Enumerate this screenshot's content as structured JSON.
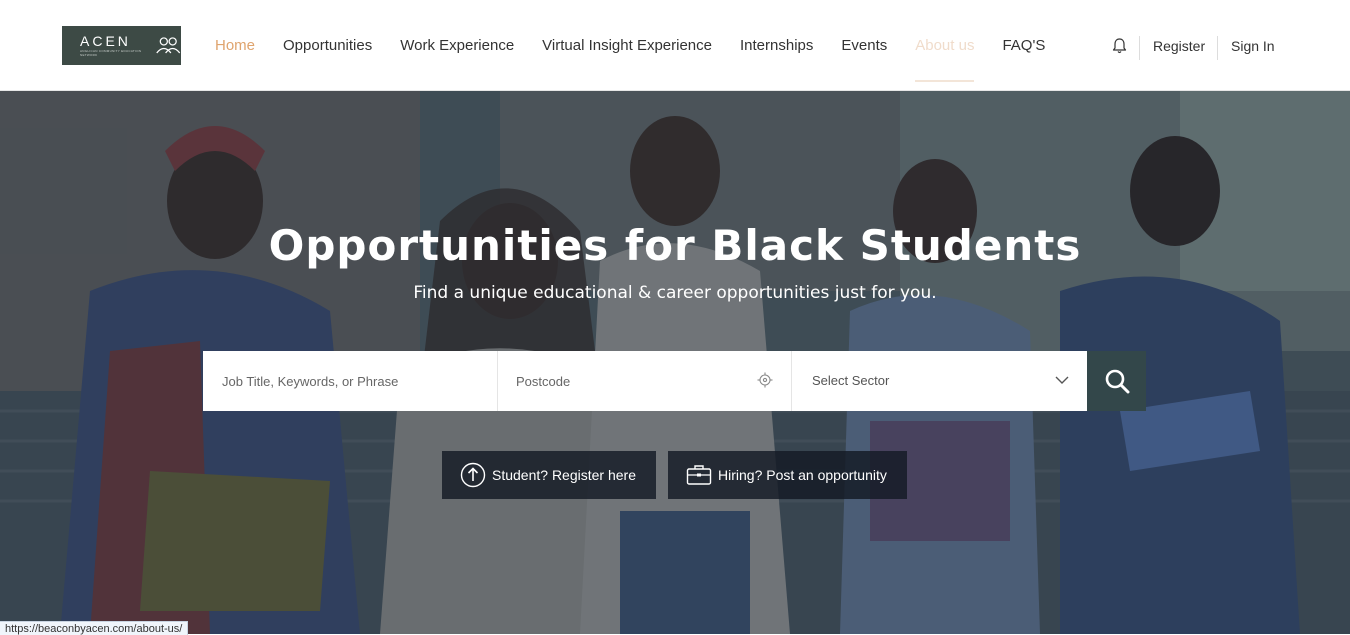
{
  "logo": {
    "word": "ACEN",
    "tagline": "ANGLICAN COMMUNITY EDUCATION NETWORK"
  },
  "nav": {
    "items": [
      {
        "label": "Home",
        "state": "active"
      },
      {
        "label": "Opportunities",
        "state": ""
      },
      {
        "label": "Work Experience",
        "state": ""
      },
      {
        "label": "Virtual Insight Experience",
        "state": ""
      },
      {
        "label": "Internships",
        "state": ""
      },
      {
        "label": "Events",
        "state": ""
      },
      {
        "label": "About us",
        "state": "hover"
      },
      {
        "label": "FAQ'S",
        "state": ""
      }
    ],
    "register": "Register",
    "signin": "Sign In"
  },
  "hero": {
    "title": "Opportunities for Black Students",
    "subtitle": "Find a unique educational & career opportunities just for you."
  },
  "search": {
    "keywords_placeholder": "Job Title, Keywords, or Phrase",
    "postcode_placeholder": "Postcode",
    "sector_selected": "Select Sector"
  },
  "cta": {
    "student": "Student? Register here",
    "hiring": "Hiring? Post an opportunity"
  },
  "status": {
    "url": "https://beaconbyacen.com/about-us/"
  },
  "colors": {
    "accent": "#dfa46e",
    "logo_bg": "#3d4a45",
    "search_button": "#33474a",
    "cta_bg": "#141a24"
  },
  "icons": [
    "people-icon",
    "bell-icon",
    "location-target-icon",
    "chevron-down-icon",
    "search-icon",
    "arrow-up-circle-icon",
    "briefcase-icon"
  ]
}
